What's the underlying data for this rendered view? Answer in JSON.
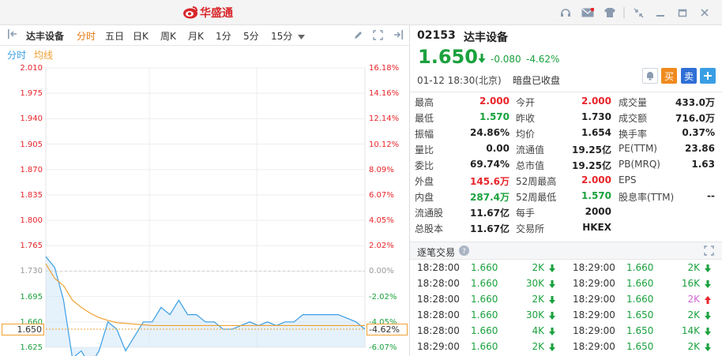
{
  "app": {
    "title": "华盛通"
  },
  "toolbar": {
    "stock_name": "达丰设备",
    "periods": [
      "分时",
      "五日",
      "日K",
      "周K",
      "月K",
      "1分",
      "5分",
      "15分"
    ],
    "active_period": "分时"
  },
  "subbar": {
    "mode": "分时",
    "avg_label": "均线"
  },
  "chart_data": {
    "type": "line",
    "title": "",
    "series": [
      {
        "name": "分时",
        "values": [
          1.75,
          1.735,
          1.69,
          1.61,
          1.62,
          1.6,
          1.62,
          1.66,
          1.65,
          1.62,
          1.64,
          1.66,
          1.66,
          1.68,
          1.67,
          1.69,
          1.67,
          1.67,
          1.66,
          1.66,
          1.65,
          1.65,
          1.655,
          1.66,
          1.655,
          1.66,
          1.655,
          1.66,
          1.66,
          1.67,
          1.67,
          1.67,
          1.67,
          1.67,
          1.665,
          1.66,
          1.65
        ]
      },
      {
        "name": "均线",
        "values": [
          1.74,
          1.72,
          1.71,
          1.69,
          1.68,
          1.672,
          1.666,
          1.662,
          1.659,
          1.658,
          1.657,
          1.656,
          1.655,
          1.655,
          1.655,
          1.655,
          1.655,
          1.655,
          1.655,
          1.655,
          1.655,
          1.655,
          1.655,
          1.655,
          1.655,
          1.655,
          1.655,
          1.655,
          1.655,
          1.655,
          1.655,
          1.655,
          1.655,
          1.655,
          1.655,
          1.655,
          1.655
        ]
      }
    ],
    "y_ticks_left": [
      "2.010",
      "1.975",
      "1.940",
      "1.905",
      "1.870",
      "1.835",
      "1.800",
      "1.765",
      "1.730",
      "1.695",
      "1.660",
      "1.625"
    ],
    "y_ticks_right": [
      "16.18%",
      "14.16%",
      "12.14%",
      "10.12%",
      "8.09%",
      "6.07%",
      "4.05%",
      "2.02%",
      "0.00%",
      "-2.02%",
      "-4.05%",
      "-6.07%"
    ],
    "ylim": [
      1.625,
      2.01
    ],
    "prev_close": 1.73,
    "current_price": "1.650",
    "current_pct": "-4.62%",
    "grid": true
  },
  "quote": {
    "code": "02153",
    "name": "达丰设备",
    "price": "1.650",
    "change": "-0.080",
    "change_pct": "-4.62%",
    "datetime": "01-12 18:30(北京)",
    "status": "暗盘已收盘",
    "buy_label": "买",
    "sell_label": "卖"
  },
  "stats": {
    "col1": [
      {
        "label": "最高",
        "value": "2.000",
        "color": "#e8242a"
      },
      {
        "label": "最低",
        "value": "1.570",
        "color": "#1aa13d"
      },
      {
        "label": "振幅",
        "value": "24.86%",
        "color": "#222222"
      },
      {
        "label": "量比",
        "value": "0.00",
        "color": "#222222"
      },
      {
        "label": "委比",
        "value": "69.74%",
        "color": "#222222"
      },
      {
        "label": "外盘",
        "value": "145.6万",
        "color": "#e8242a"
      },
      {
        "label": "内盘",
        "value": "287.4万",
        "color": "#1aa13d"
      },
      {
        "label": "流通股",
        "value": "11.67亿",
        "color": "#222222"
      },
      {
        "label": "总股本",
        "value": "11.67亿",
        "color": "#222222"
      }
    ],
    "col2": [
      {
        "label": "今开",
        "value": "2.000",
        "color": "#e8242a"
      },
      {
        "label": "昨收",
        "value": "1.730",
        "color": "#222222"
      },
      {
        "label": "均价",
        "value": "1.654",
        "color": "#222222"
      },
      {
        "label": "流通值",
        "value": "19.25亿",
        "color": "#222222"
      },
      {
        "label": "总市值",
        "value": "19.25亿",
        "color": "#222222"
      },
      {
        "label": "52周最高",
        "value": "2.000",
        "color": "#e8242a"
      },
      {
        "label": "52周最低",
        "value": "1.570",
        "color": "#1aa13d"
      },
      {
        "label": "每手",
        "value": "2000",
        "color": "#222222"
      },
      {
        "label": "交易所",
        "value": "HKEX",
        "color": "#222222"
      }
    ],
    "col3": [
      {
        "label": "成交量",
        "value": "433.0万",
        "color": "#222222"
      },
      {
        "label": "成交额",
        "value": "716.0万",
        "color": "#222222"
      },
      {
        "label": "换手率",
        "value": "0.37%",
        "color": "#222222"
      },
      {
        "label": "PE(TTM)",
        "value": "23.86",
        "color": "#222222"
      },
      {
        "label": "PB(MRQ)",
        "value": "1.63",
        "color": "#222222"
      },
      {
        "label": "EPS",
        "value": "",
        "color": "#222222"
      },
      {
        "label": "股息率(TTM)",
        "value": "--",
        "color": "#222222"
      }
    ]
  },
  "trades": {
    "title": "逐笔交易",
    "left": [
      {
        "time": "18:28:00",
        "price": "1.660",
        "vol": "2K",
        "dir": "down"
      },
      {
        "time": "18:28:00",
        "price": "1.660",
        "vol": "30K",
        "dir": "down"
      },
      {
        "time": "18:28:00",
        "price": "1.660",
        "vol": "2K",
        "dir": "down"
      },
      {
        "time": "18:28:00",
        "price": "1.660",
        "vol": "30K",
        "dir": "down"
      },
      {
        "time": "18:28:00",
        "price": "1.660",
        "vol": "4K",
        "dir": "down"
      },
      {
        "time": "18:29:00",
        "price": "1.660",
        "vol": "2K",
        "dir": "down"
      }
    ],
    "right": [
      {
        "time": "18:29:00",
        "price": "1.660",
        "vol": "2K",
        "dir": "down"
      },
      {
        "time": "18:29:00",
        "price": "1.660",
        "vol": "16K",
        "dir": "down"
      },
      {
        "time": "18:29:00",
        "price": "1.660",
        "vol": "2K",
        "dir": "up"
      },
      {
        "time": "18:29:00",
        "price": "1.650",
        "vol": "2K",
        "dir": "down"
      },
      {
        "time": "18:29:00",
        "price": "1.650",
        "vol": "14K",
        "dir": "down"
      },
      {
        "time": "18:29:00",
        "price": "1.650",
        "vol": "2K",
        "dir": "down"
      }
    ]
  },
  "colors": {
    "up": "#e8242a",
    "down": "#1aa13d",
    "accent": "#e4770f",
    "line": "#3a9ee4",
    "avg": "#f0a030"
  }
}
